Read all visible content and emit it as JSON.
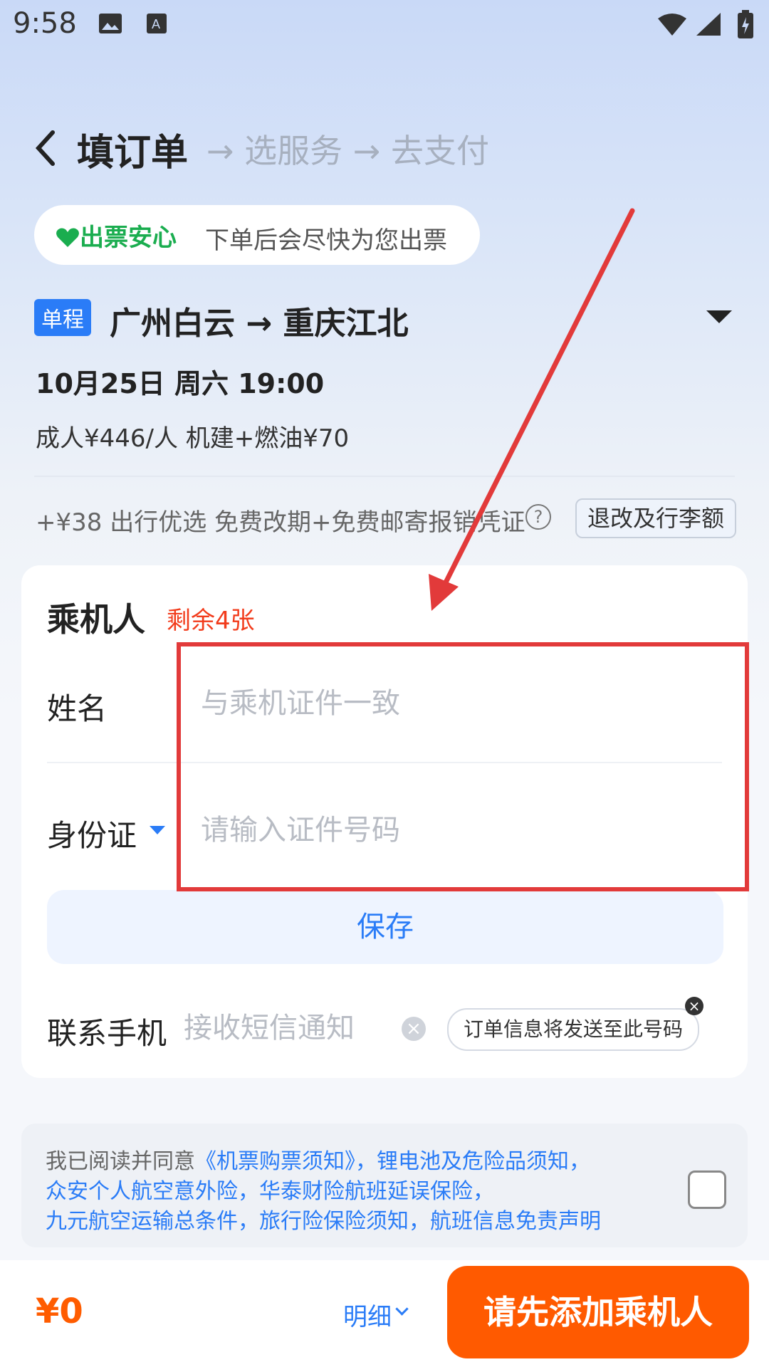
{
  "status_bar": {
    "time": "9:58"
  },
  "header": {
    "title": "填订单",
    "steps": "→ 选服务 → 去支付"
  },
  "assurance": {
    "badge": "出票安心",
    "text": "下单后会尽快为您出票"
  },
  "flight": {
    "trip_type": "单程",
    "route": "广州白云 → 重庆江北",
    "datetime": "10月25日 周六 19:00",
    "price_line": "成人¥446/人  机建+燃油¥70",
    "extra_service": "+¥38 出行优选 免费改期+免费邮寄报销凭证",
    "rules_button": "退改及行李额"
  },
  "passenger": {
    "title": "乘机人",
    "remaining": "剩余4张",
    "name_label": "姓名",
    "name_placeholder": "与乘机证件一致",
    "id_label": "身份证",
    "id_placeholder": "请输入证件号码",
    "save_label": "保存",
    "phone_label": "联系手机",
    "phone_placeholder": "接收短信通知",
    "tooltip": "订单信息将发送至此号码"
  },
  "agreement": {
    "line1_prefix": "我已阅读并同意",
    "line1_links": "《机票购票须知》，锂电池及危险品须知，",
    "line2": "众安个人航空意外险，华泰财险航班延误保险，",
    "line3": "九元航空运输总条件，旅行险保险须知，航班信息免责声明"
  },
  "footer": {
    "total": "¥0",
    "detail_label": "明细",
    "cta_label": "请先添加乘机人"
  },
  "colors": {
    "accent": "#2a7cf7",
    "cta": "#ff5a00",
    "annotation": "#e23a3a",
    "success": "#1aad4f"
  }
}
